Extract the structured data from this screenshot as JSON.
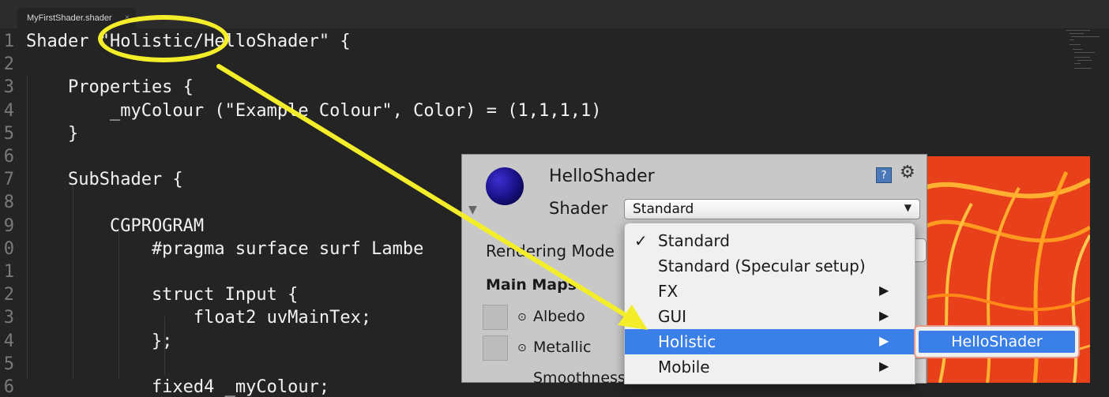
{
  "tab": {
    "title": "MyFirstShader.shader",
    "close": "×"
  },
  "code_lines": [
    {
      "n": "1",
      "text": "Shader \"Holistic/HelloShader\" {"
    },
    {
      "n": "2",
      "text": ""
    },
    {
      "n": "3",
      "text": "    Properties {"
    },
    {
      "n": "4",
      "text": "        _myColour (\"Example Colour\", Color) = (1,1,1,1)"
    },
    {
      "n": "5",
      "text": "    }"
    },
    {
      "n": "6",
      "text": ""
    },
    {
      "n": "7",
      "text": "    SubShader {"
    },
    {
      "n": "8",
      "text": ""
    },
    {
      "n": "9",
      "text": "        CGPROGRAM"
    },
    {
      "n": "0",
      "text": "            #pragma surface surf Lambe"
    },
    {
      "n": "1",
      "text": ""
    },
    {
      "n": "2",
      "text": "            struct Input {"
    },
    {
      "n": "3",
      "text": "                float2 uvMainTex;"
    },
    {
      "n": "4",
      "text": "            };"
    },
    {
      "n": "5",
      "text": ""
    },
    {
      "n": "6",
      "text": "            fixed4 _myColour;"
    }
  ],
  "inspector": {
    "material_name": "HelloShader",
    "shader_label": "Shader",
    "shader_value": "Standard",
    "help_icon": "?",
    "gear_icon": "⚙",
    "rendering_mode_label": "Rendering Mode",
    "main_maps_label": "Main Maps",
    "albedo_label": "Albedo",
    "metallic_label": "Metallic",
    "smoothness_label": "Smoothness"
  },
  "menu": {
    "items": [
      {
        "label": "Standard",
        "checked": "✓",
        "submenu": ""
      },
      {
        "label": "Standard (Specular setup)",
        "checked": "",
        "submenu": ""
      },
      {
        "label": "FX",
        "checked": "",
        "submenu": "▶"
      },
      {
        "label": "GUI",
        "checked": "",
        "submenu": "▶"
      },
      {
        "label": "Holistic",
        "checked": "",
        "submenu": "▶"
      },
      {
        "label": "Mobile",
        "checked": "",
        "submenu": "▶"
      }
    ],
    "selected": "Holistic"
  },
  "submenu": {
    "item": "HelloShader"
  },
  "colors": {
    "highlight": "#f4ee2a",
    "selection": "#3b7fe8",
    "editor_bg": "#242424"
  }
}
